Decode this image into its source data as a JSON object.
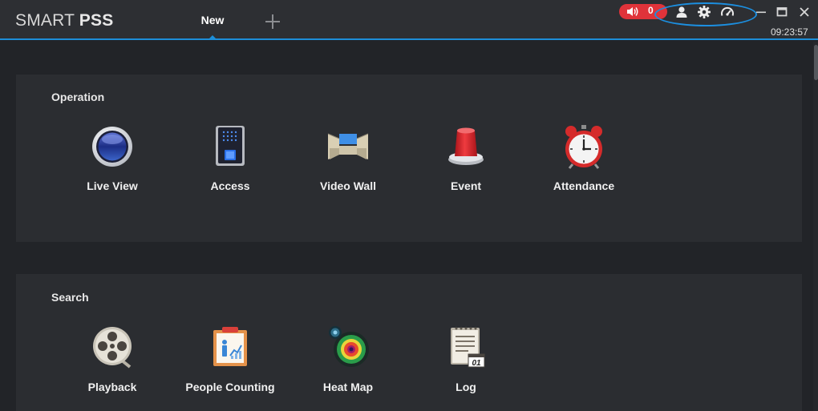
{
  "app": {
    "logo_light": "SMART",
    "logo_bold": "PSS"
  },
  "tabs": [
    {
      "label": "New",
      "active": true
    }
  ],
  "header": {
    "alarm_count": "0",
    "clock": "09:23:57",
    "icons": [
      "speaker-icon",
      "user-icon",
      "gear-icon",
      "speedometer-icon",
      "minimize-icon",
      "maximize-icon",
      "close-icon"
    ]
  },
  "colors": {
    "accent": "#1d8ed8",
    "alarm": "#e0333a",
    "panel": "#2b2d31",
    "background": "#222428"
  },
  "sections": [
    {
      "title": "Operation",
      "items": [
        {
          "label": "Live View",
          "icon": "live-view-icon"
        },
        {
          "label": "Access",
          "icon": "access-icon"
        },
        {
          "label": "Video Wall",
          "icon": "video-wall-icon"
        },
        {
          "label": "Event",
          "icon": "event-icon"
        },
        {
          "label": "Attendance",
          "icon": "attendance-icon"
        }
      ]
    },
    {
      "title": "Search",
      "items": [
        {
          "label": "Playback",
          "icon": "playback-icon"
        },
        {
          "label": "People Counting",
          "icon": "people-counting-icon"
        },
        {
          "label": "Heat Map",
          "icon": "heat-map-icon"
        },
        {
          "label": "Log",
          "icon": "log-icon",
          "badge": "01"
        }
      ]
    }
  ]
}
